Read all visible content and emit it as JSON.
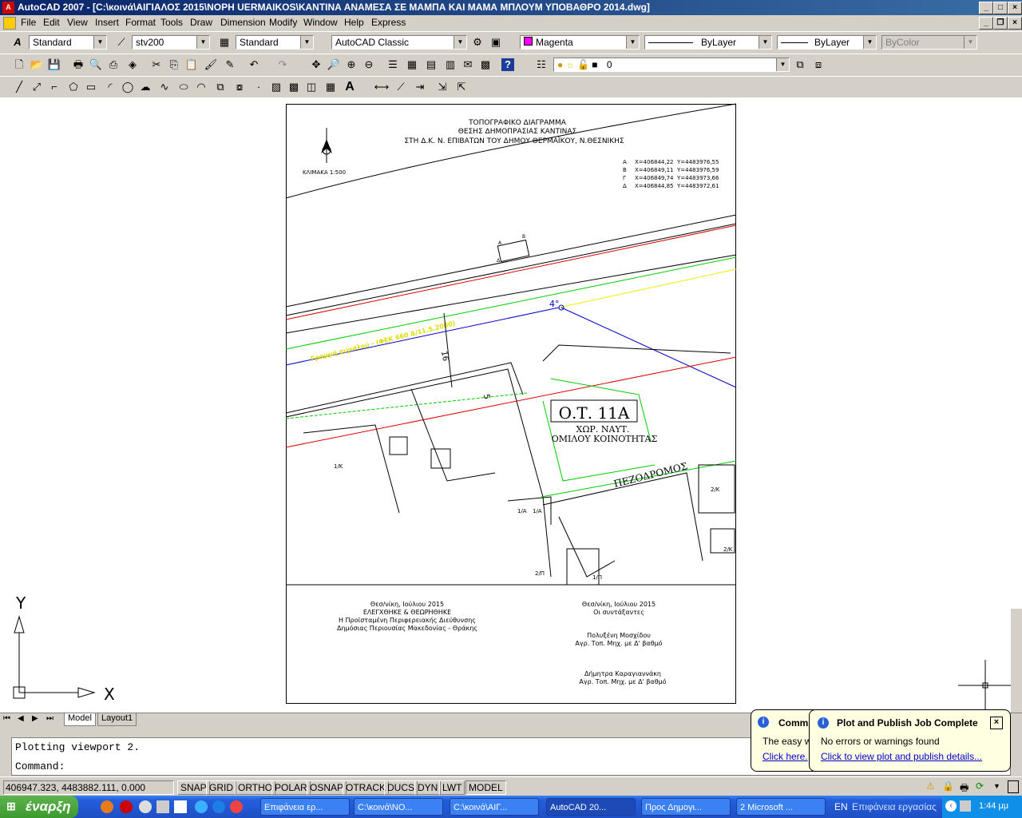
{
  "window": {
    "title": "AutoCAD 2007 - [C:\\κοινά\\ΑΙΓΙΑΛΟΣ 2015\\ΝΟΡΗ UERMAIKOS\\ΚΑΝΤΙΝΑ ΑΝΑΜΕΣΑ ΣΕ ΜΑΜΠΑ ΚΑΙ ΜΑΜΑ ΜΠΛΟΥΜ ΥΠΟΒΑΘΡΟ 2014.dwg]"
  },
  "menu": [
    "File",
    "Edit",
    "View",
    "Insert",
    "Format",
    "Tools",
    "Draw",
    "Dimension",
    "Modify",
    "Window",
    "Help",
    "Express"
  ],
  "styles_toolbar": {
    "text_style": "Standard",
    "dim_style": "stv200",
    "table_style": "Standard",
    "workspace": "AutoCAD Classic"
  },
  "properties_toolbar": {
    "color": "Magenta",
    "color_hex": "#ff00ff",
    "linetype": "ByLayer",
    "lineweight": "ByLayer",
    "plotstyle": "ByColor"
  },
  "layers_toolbar": {
    "current_layer": "0"
  },
  "drawing": {
    "title_lines": [
      "ΤΟΠΟΓΡΑΦΙΚΟ ΔΙΑΓΡΑΜΜΑ",
      "ΘΕΣΗΣ ΔΗΜΟΠΡΑΣΙΑΣ ΚΑΝΤΙΝΑΣ",
      "ΣΤΗ Δ.Κ. Ν. ΕΠΙΒΑΤΩΝ ΤΟΥ ΔΗΜΟΥ ΘΕΡΜΑΪΚΟΥ, Ν.ΘΕΣΝΙΚΗΣ"
    ],
    "scale": "ΚΛΙΜΑΚΑ 1:500",
    "coords": [
      {
        "pt": "Α",
        "x": "X=406844,22",
        "y": "Y=4483976,55"
      },
      {
        "pt": "Β",
        "x": "X=406849,11",
        "y": "Y=4483976,59"
      },
      {
        "pt": "Γ",
        "x": "X=406849,74",
        "y": "Y=4483973,66"
      },
      {
        "pt": "Δ",
        "x": "X=406844,85",
        "y": "Y=4483972,61"
      }
    ],
    "block_label": "Ο.Τ. 11Α",
    "block_sub1": "ΧΩΡ. ΝΑΥΤ.",
    "block_sub2": "ΟΜΙΛΟΥ ΚΟΙΝΟΤΗΤΑΣ",
    "street": "ΠΕΖΟΔΡΟΜΟΣ",
    "yellow_text": "Γραμμή αιγιαλού - (ΦΕΚ 660 Δ/11.5.2000)",
    "angle_label": "4°",
    "dim_16": "16",
    "dim_5": "5",
    "footer_left": [
      "Θεσ/νίκη,      Ιούλιου  2015",
      "ΕΛΕΓΧΘΗΚΕ       & ΘΕΩΡΗΘΗΚΕ",
      "Η Προϊσταμένη Περιφερειακής Διεύθυνσης",
      "Δημόσιας Περιουσίας Μακεδονίας - Θράκης"
    ],
    "footer_right": [
      "Θεσ/νίκη,     Ιούλιου 2015",
      "Οι συντάξαντες",
      "Πολυξένη Μοσχίδου",
      "Αγρ. Τοπ. Μηχ. με Δ' βαθμό",
      "Δήμητρα Καραγιαννάκη",
      "Αγρ. Τοπ. Μηχ. με Δ' βαθμό"
    ],
    "lot_labels": [
      "1/Κ",
      "1/Α",
      "1/Α",
      "2/Π",
      "1/Π",
      "2/Κ",
      "2/Κ"
    ]
  },
  "ucs": {
    "x": "X",
    "y": "Y"
  },
  "tabs": [
    "Model",
    "Layout1"
  ],
  "command": {
    "line1": "Plotting viewport 2.",
    "line2": "Command:"
  },
  "status": {
    "coords": "406947.323, 4483882.111, 0.000",
    "toggles": [
      "SNAP",
      "GRID",
      "ORTHO",
      "POLAR",
      "OSNAP",
      "OTRACK",
      "DUCS",
      "DYN",
      "LWT",
      "MODEL"
    ]
  },
  "balloon_back": {
    "title": "Commu",
    "body": "The easy w",
    "link": "Click here."
  },
  "balloon": {
    "title": "Plot and Publish Job Complete",
    "body": "No errors or warnings found",
    "link": "Click to view plot and publish details..."
  },
  "taskbar": {
    "start": "έναρξη",
    "tasks": [
      "Επιφάνεια ερ...",
      "C:\\κοινά\\ΝΟ...",
      "C:\\κοινά\\ΑΙΓ...",
      "AutoCAD 20...",
      "Προς Δημογι...",
      "2 Microsoft ..."
    ],
    "lang": "EN",
    "desktop": "Επιφάνεια εργασίας",
    "clock": "1:44 μμ"
  }
}
